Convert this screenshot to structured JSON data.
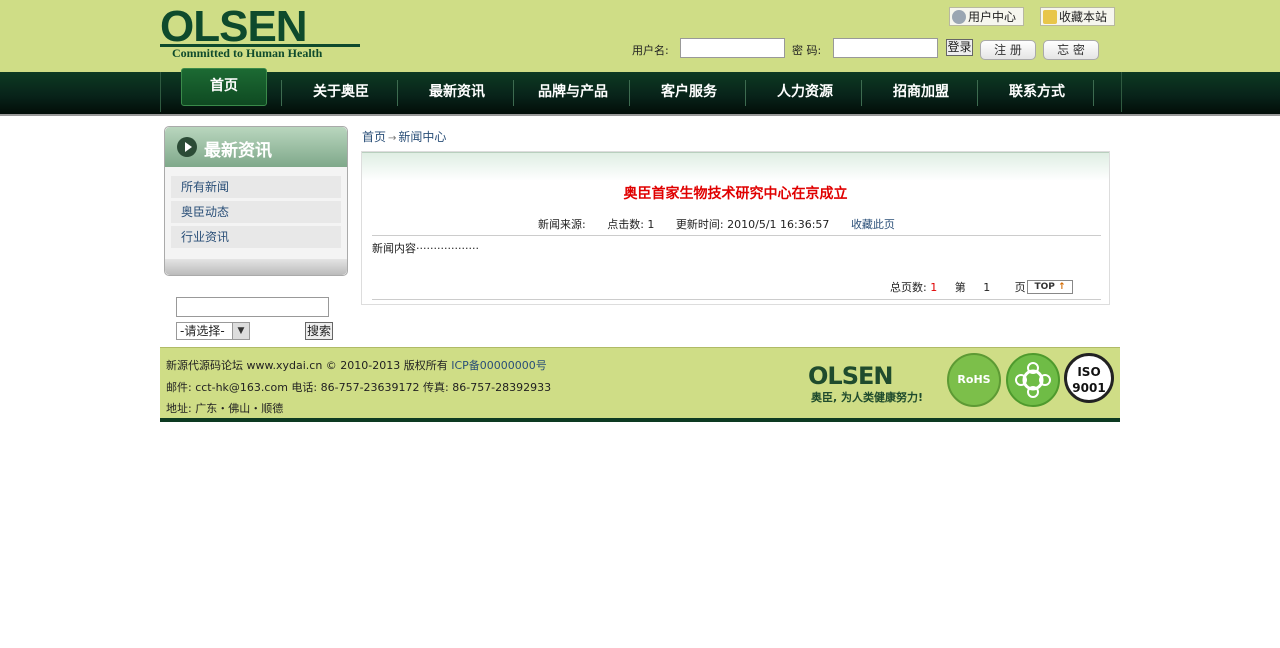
{
  "header": {
    "logo_word": "OLSEN",
    "logo_tagline": "Committed to Human Health",
    "user_center": "用户中心",
    "bookmark": "收藏本站"
  },
  "login": {
    "username_label": "用户名:",
    "password_label": "密 码:",
    "login_button": "登录",
    "register_button": "注 册",
    "forgot_button": "忘 密"
  },
  "nav": {
    "items": [
      "首页",
      "关于奥臣",
      "最新资讯",
      "品牌与产品",
      "客户服务",
      "人力资源",
      "招商加盟",
      "联系方式"
    ]
  },
  "sidebar": {
    "title": "最新资讯",
    "items": [
      "所有新闻",
      "奥臣动态",
      "行业资讯"
    ]
  },
  "search": {
    "select_value": "-请选择-",
    "button": "搜索"
  },
  "breadcrumb": [
    "首页",
    "新闻中心"
  ],
  "article": {
    "title": "奥臣首家生物技术研究中心在京成立",
    "source": "新闻来源:",
    "clicks": "点击数: 1",
    "updated": "更新时间: 2010/5/1 16:36:57",
    "favorite": "收藏此页",
    "body": "新闻内容··················",
    "pager_total_label": "总页数:",
    "pager_total": "1",
    "pager_page_prefix": "第",
    "pager_page": "1",
    "pager_page_suffix": "页",
    "top_label": "TOP"
  },
  "footer": {
    "line1": "新源代源码论坛 www.xydai.cn © 2010-2013 版权所有",
    "icp": "ICP备00000000号",
    "line2": "邮件: cct-hk@163.com 电话: 86-757-23639172  传真: 86-757-28392933",
    "line3": "地址: 广东・佛山・顺德",
    "logo_word": "OLSEN",
    "logo_slogan": "奥臣, 为人类健康努力!",
    "badges": [
      "RoHS",
      "ISO 9001"
    ]
  },
  "colors": {
    "header_bg": "#cfdd86",
    "nav_bg": "#08241a",
    "brand_green": "#0e4a2c",
    "title_red": "#e00000",
    "link_blue": "#2a4f78"
  }
}
